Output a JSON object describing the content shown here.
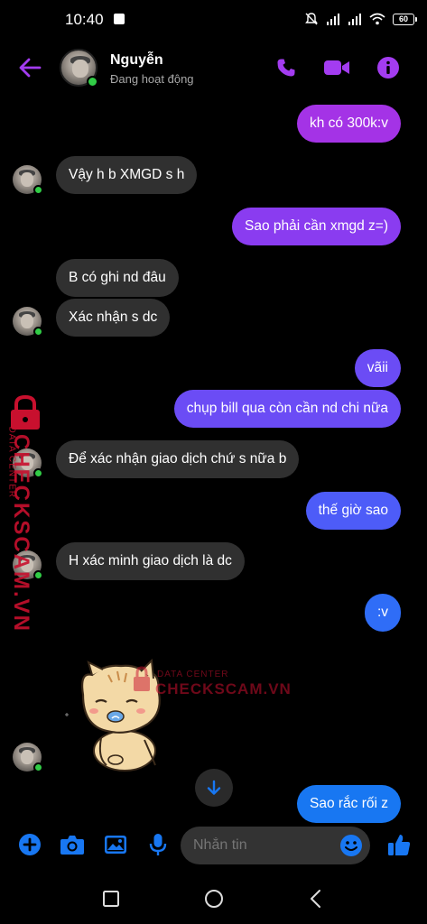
{
  "status_bar": {
    "time": "10:40",
    "battery": "60"
  },
  "header": {
    "contact_name": "Nguyễn",
    "contact_status": "Đang hoạt động"
  },
  "messages": [
    {
      "side": "out",
      "text": "kh có 300k:v"
    },
    {
      "side": "in",
      "text": "Vậy h b XMGD s h"
    },
    {
      "side": "out",
      "text": "Sao phải cần xmgd z=)"
    },
    {
      "side": "in",
      "text": "B có ghi nd đâu"
    },
    {
      "side": "in",
      "text": "Xác nhận s dc"
    },
    {
      "side": "out",
      "text": "vãii"
    },
    {
      "side": "out",
      "text": "chụp bill qua còn cần nd chi nữa"
    },
    {
      "side": "in",
      "text": "Để xác nhận giao dịch chứ s nữa b"
    },
    {
      "side": "out",
      "text": "thế giờ sao"
    },
    {
      "side": "in",
      "text": "H xác minh giao dịch là dc"
    },
    {
      "side": "out",
      "text": ":v"
    },
    {
      "side": "in",
      "type": "sticker",
      "icon": "crying-cat-sticker"
    },
    {
      "side": "out",
      "text": "Sao rắc rối z"
    }
  ],
  "composer": {
    "placeholder": "Nhắn tin"
  },
  "watermark": {
    "brand": "CHECKSCAM.VN",
    "tagline": "DATA CENTER"
  },
  "colors": {
    "accent": "#a33cf0",
    "incoming_bubble": "#303030",
    "online": "#31cc46",
    "composer_icon": "#1877f2",
    "watermark": "#c8102e"
  }
}
